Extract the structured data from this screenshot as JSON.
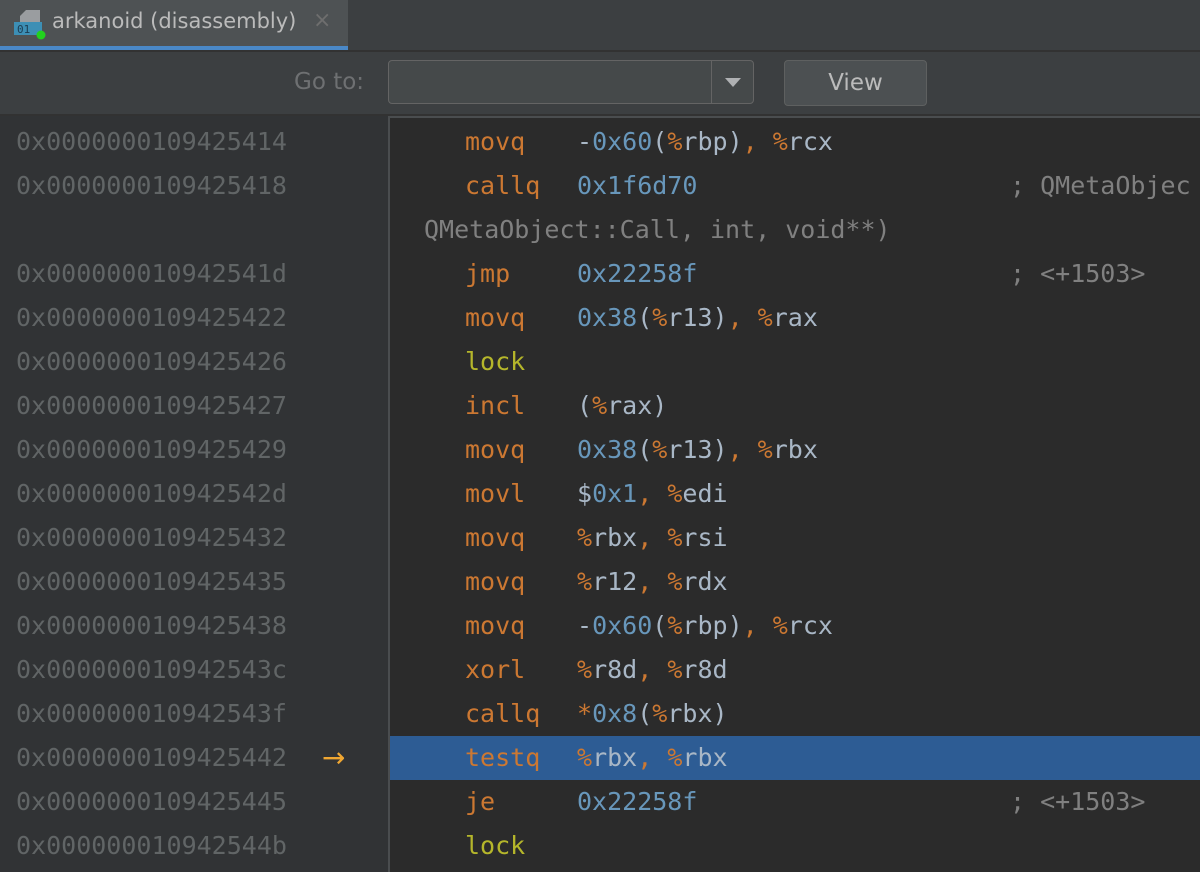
{
  "tab": {
    "title": "arkanoid (disassembly)",
    "icon_text": "01",
    "close": "×",
    "accent": "#4a88c7"
  },
  "toolbar": {
    "goto_label": "Go to:",
    "goto_value": "",
    "view_label": "View"
  },
  "current_arrow": "→",
  "rows": [
    {
      "addr": "0x0000000109425414",
      "mn": "movq",
      "ops": [
        [
          "-",
          "punc"
        ],
        [
          "0x60",
          "num"
        ],
        [
          "(",
          "punc"
        ],
        [
          "%",
          "pct"
        ],
        [
          "rbp",
          "reg"
        ],
        [
          ")",
          "punc"
        ],
        [
          ", ",
          "comma"
        ],
        [
          "%",
          "pct"
        ],
        [
          "rcx",
          "reg"
        ]
      ],
      "comment": ""
    },
    {
      "addr": "0x0000000109425418",
      "mn": "callq",
      "ops": [
        [
          "0x1f6d70",
          "num"
        ]
      ],
      "comment": "; QMetaObjec"
    },
    {
      "addr": "",
      "mn": "",
      "ops": [],
      "comment": "",
      "continuation": "QMetaObject::Call, int, void**)"
    },
    {
      "addr": "0x000000010942541d",
      "mn": "jmp",
      "ops": [
        [
          "0x22258f",
          "num"
        ]
      ],
      "comment": "; <+1503>"
    },
    {
      "addr": "0x0000000109425422",
      "mn": "movq",
      "ops": [
        [
          "0x38",
          "num"
        ],
        [
          "(",
          "punc"
        ],
        [
          "%",
          "pct"
        ],
        [
          "r13",
          "reg"
        ],
        [
          ")",
          "punc"
        ],
        [
          ", ",
          "comma"
        ],
        [
          "%",
          "pct"
        ],
        [
          "rax",
          "reg"
        ]
      ],
      "comment": ""
    },
    {
      "addr": "0x0000000109425426",
      "mn": "lock",
      "prefix": true,
      "ops": [],
      "comment": ""
    },
    {
      "addr": "0x0000000109425427",
      "mn": "incl",
      "ops": [
        [
          "(",
          "punc"
        ],
        [
          "%",
          "pct"
        ],
        [
          "rax",
          "reg"
        ],
        [
          ")",
          "punc"
        ]
      ],
      "comment": ""
    },
    {
      "addr": "0x0000000109425429",
      "mn": "movq",
      "ops": [
        [
          "0x38",
          "num"
        ],
        [
          "(",
          "punc"
        ],
        [
          "%",
          "pct"
        ],
        [
          "r13",
          "reg"
        ],
        [
          ")",
          "punc"
        ],
        [
          ", ",
          "comma"
        ],
        [
          "%",
          "pct"
        ],
        [
          "rbx",
          "reg"
        ]
      ],
      "comment": ""
    },
    {
      "addr": "0x000000010942542d",
      "mn": "movl",
      "ops": [
        [
          "$",
          "punc"
        ],
        [
          "0x1",
          "num"
        ],
        [
          ", ",
          "comma"
        ],
        [
          "%",
          "pct"
        ],
        [
          "edi",
          "reg"
        ]
      ],
      "comment": ""
    },
    {
      "addr": "0x0000000109425432",
      "mn": "movq",
      "ops": [
        [
          "%",
          "pct"
        ],
        [
          "rbx",
          "reg"
        ],
        [
          ", ",
          "comma"
        ],
        [
          "%",
          "pct"
        ],
        [
          "rsi",
          "reg"
        ]
      ],
      "comment": ""
    },
    {
      "addr": "0x0000000109425435",
      "mn": "movq",
      "ops": [
        [
          "%",
          "pct"
        ],
        [
          "r12",
          "reg"
        ],
        [
          ", ",
          "comma"
        ],
        [
          "%",
          "pct"
        ],
        [
          "rdx",
          "reg"
        ]
      ],
      "comment": ""
    },
    {
      "addr": "0x0000000109425438",
      "mn": "movq",
      "ops": [
        [
          "-",
          "punc"
        ],
        [
          "0x60",
          "num"
        ],
        [
          "(",
          "punc"
        ],
        [
          "%",
          "pct"
        ],
        [
          "rbp",
          "reg"
        ],
        [
          ")",
          "punc"
        ],
        [
          ", ",
          "comma"
        ],
        [
          "%",
          "pct"
        ],
        [
          "rcx",
          "reg"
        ]
      ],
      "comment": ""
    },
    {
      "addr": "0x000000010942543c",
      "mn": "xorl",
      "ops": [
        [
          "%",
          "pct"
        ],
        [
          "r8d",
          "reg"
        ],
        [
          ", ",
          "comma"
        ],
        [
          "%",
          "pct"
        ],
        [
          "r8d",
          "reg"
        ]
      ],
      "comment": ""
    },
    {
      "addr": "0x000000010942543f",
      "mn": "callq",
      "ops": [
        [
          "*",
          "star"
        ],
        [
          "0x8",
          "num"
        ],
        [
          "(",
          "punc"
        ],
        [
          "%",
          "pct"
        ],
        [
          "rbx",
          "reg"
        ],
        [
          ")",
          "punc"
        ]
      ],
      "comment": ""
    },
    {
      "addr": "0x0000000109425442",
      "mn": "testq",
      "current": true,
      "ops": [
        [
          "%",
          "pct"
        ],
        [
          "rbx",
          "reg"
        ],
        [
          ", ",
          "comma"
        ],
        [
          "%",
          "pct"
        ],
        [
          "rbx",
          "reg"
        ]
      ],
      "comment": ""
    },
    {
      "addr": "0x0000000109425445",
      "mn": "je",
      "ops": [
        [
          "0x22258f",
          "num"
        ]
      ],
      "comment": "; <+1503>"
    },
    {
      "addr": "0x000000010942544b",
      "mn": "lock",
      "prefix": true,
      "ops": [],
      "comment": ""
    }
  ]
}
